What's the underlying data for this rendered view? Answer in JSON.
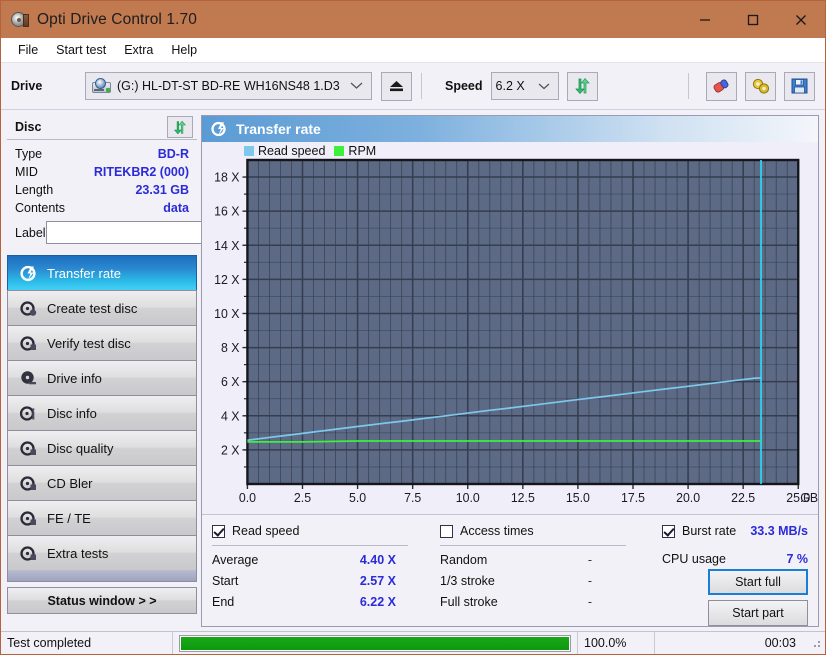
{
  "window": {
    "title": "Opti Drive Control 1.70",
    "icon": "disc-icon",
    "controls": {
      "minimize": "minimize-icon",
      "maximize": "maximize-icon",
      "close": "close-icon"
    },
    "titlebar_color": "#c1794f"
  },
  "menu": {
    "items": [
      "File",
      "Start test",
      "Extra",
      "Help"
    ]
  },
  "toolbar": {
    "drive_label": "Drive",
    "drive_value": "(G:)  HL-DT-ST BD-RE  WH16NS48 1.D3",
    "eject_icon": "eject-icon",
    "speed_label": "Speed",
    "speed_value": "6.2 X",
    "refresh_icon": "refresh-icon",
    "erase_icon": "eraser-icon",
    "settings_icon": "tools-icon",
    "save_icon": "save-icon"
  },
  "disc": {
    "header": "Disc",
    "refresh_icon": "refresh-icon",
    "rows": [
      {
        "key": "Type",
        "value": "BD-R"
      },
      {
        "key": "MID",
        "value": "RITEKBR2 (000)"
      },
      {
        "key": "Length",
        "value": "23.31 GB"
      },
      {
        "key": "Contents",
        "value": "data"
      }
    ],
    "label_key": "Label",
    "label_value": "",
    "label_placeholder": "",
    "label_button_icon": "disc-icon"
  },
  "sidebar": {
    "items": [
      {
        "label": "Transfer rate",
        "icon": "disc-bolt-icon",
        "active": true
      },
      {
        "label": "Create test disc",
        "icon": "disc-create-icon",
        "active": false
      },
      {
        "label": "Verify test disc",
        "icon": "disc-verify-icon",
        "active": false
      },
      {
        "label": "Drive info",
        "icon": "drive-info-icon",
        "active": false
      },
      {
        "label": "Disc info",
        "icon": "disc-info-icon",
        "active": false
      },
      {
        "label": "Disc quality",
        "icon": "disc-quality-icon",
        "active": false
      },
      {
        "label": "CD Bler",
        "icon": "disc-bler-icon",
        "active": false
      },
      {
        "label": "FE / TE",
        "icon": "disc-fete-icon",
        "active": false
      },
      {
        "label": "Extra tests",
        "icon": "disc-extra-icon",
        "active": false
      }
    ],
    "status_window_button": "Status window > >"
  },
  "panel": {
    "title": "Transfer rate",
    "icon": "disc-bolt-icon"
  },
  "chart_data": {
    "type": "line",
    "title": "Transfer rate",
    "xlabel": "GB",
    "ylabel": "X",
    "xlim": [
      0.0,
      25.0
    ],
    "ylim": [
      0.0,
      19.0
    ],
    "xticks": [
      0.0,
      2.5,
      5.0,
      7.5,
      10.0,
      12.5,
      15.0,
      17.5,
      20.0,
      22.5,
      25.0
    ],
    "xticklabels": [
      "0.0",
      "2.5",
      "5.0",
      "7.5",
      "10.0",
      "12.5",
      "15.0",
      "17.5",
      "20.0",
      "22.5",
      "25.0"
    ],
    "x_axis_unit": "GB",
    "yticks": [
      2,
      4,
      6,
      8,
      10,
      12,
      14,
      16,
      18
    ],
    "yticklabels": [
      "2 X",
      "4 X",
      "6 X",
      "8 X",
      "10 X",
      "12 X",
      "14 X",
      "16 X",
      "18 X"
    ],
    "grid": true,
    "legend_position": "top-left",
    "plot_bg": "#5c6a85",
    "grid_color": "#353d4f",
    "legend": [
      {
        "name": "Read speed",
        "color": "#7ec8ec"
      },
      {
        "name": "RPM",
        "color": "#3cf03c"
      }
    ],
    "markers": [
      {
        "name": "disc-end-marker",
        "x": 23.31,
        "color": "#2fd2ee"
      }
    ],
    "series": [
      {
        "name": "Read speed",
        "color": "#7ec8ec",
        "x": [
          0.0,
          1.0,
          2.0,
          3.0,
          4.0,
          5.0,
          6.0,
          7.0,
          8.0,
          9.0,
          10.0,
          11.0,
          12.0,
          13.0,
          14.0,
          15.0,
          16.0,
          17.0,
          18.0,
          19.0,
          20.0,
          21.0,
          22.0,
          23.0,
          23.31
        ],
        "y": [
          2.57,
          2.73,
          2.89,
          3.05,
          3.21,
          3.37,
          3.53,
          3.68,
          3.84,
          4.0,
          4.16,
          4.32,
          4.47,
          4.63,
          4.79,
          4.95,
          5.1,
          5.26,
          5.42,
          5.58,
          5.73,
          5.89,
          6.05,
          6.2,
          6.22
        ]
      },
      {
        "name": "RPM",
        "color": "#3cf03c",
        "x": [
          0.0,
          2.5,
          5.0,
          10.0,
          15.0,
          20.0,
          23.31
        ],
        "y": [
          2.47,
          2.47,
          2.52,
          2.52,
          2.52,
          2.52,
          2.52
        ]
      }
    ]
  },
  "stats": {
    "read_speed": {
      "checkbox_label": "Read speed",
      "checked": true,
      "rows": [
        {
          "key": "Average",
          "value": "4.40 X"
        },
        {
          "key": "Start",
          "value": "2.57 X"
        },
        {
          "key": "End",
          "value": "6.22 X"
        }
      ]
    },
    "access_times": {
      "checkbox_label": "Access times",
      "checked": false,
      "rows": [
        {
          "key": "Random",
          "value": "-"
        },
        {
          "key": "1/3 stroke",
          "value": "-"
        },
        {
          "key": "Full stroke",
          "value": "-"
        }
      ]
    },
    "burst": {
      "checkbox_label": "Burst rate",
      "checked": true,
      "value": "33.3 MB/s",
      "cpu_key": "CPU usage",
      "cpu_value": "7 %"
    },
    "buttons": {
      "start_full": "Start full",
      "start_part": "Start part"
    }
  },
  "statusbar": {
    "text": "Test completed",
    "progress_percent": 100.0,
    "progress_label": "100.0%",
    "elapsed": "00:03"
  }
}
